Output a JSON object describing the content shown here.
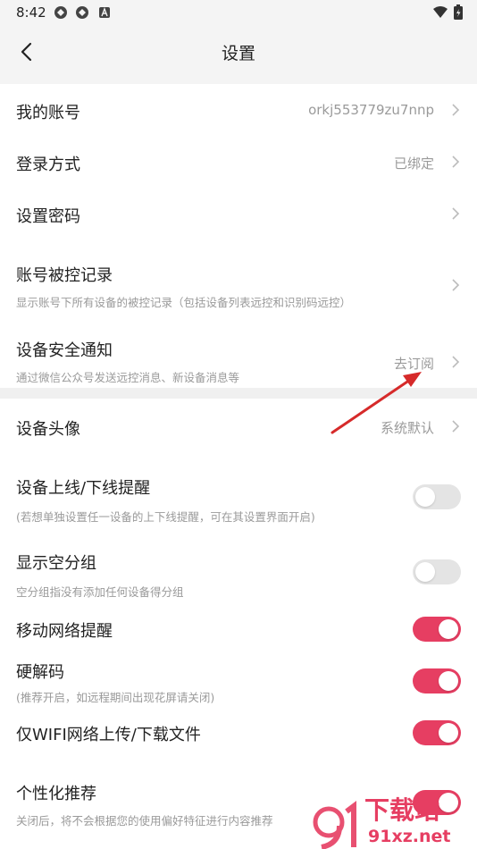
{
  "status_bar": {
    "time": "8:42"
  },
  "header": {
    "title": "设置"
  },
  "rows": [
    {
      "title": "我的账号",
      "value": "orkj553779zu7nnp"
    },
    {
      "title": "登录方式",
      "value": "已绑定"
    },
    {
      "title": "设置密码"
    },
    {
      "title": "账号被控记录",
      "subtitle": "显示账号下所有设备的被控记录（包括设备列表远控和识别码远控）"
    },
    {
      "title": "设备安全通知",
      "subtitle": "通过微信公众号发送远控消息、新设备消息等",
      "value": "去订阅"
    },
    {
      "title": "设备头像",
      "value": "系统默认"
    }
  ],
  "toggles": [
    {
      "title": "设备上线/下线提醒",
      "subtitle": "(若想单独设置任一设备的上下线提醒，可在其设置界面开启)",
      "on": false
    },
    {
      "title": "显示空分组",
      "subtitle": "空分组指没有添加任何设备得分组",
      "on": false
    },
    {
      "title": "移动网络提醒",
      "on": true
    },
    {
      "title": "硬解码",
      "subtitle": "(推荐开启，如远程期间出现花屏请关闭)",
      "on": true
    },
    {
      "title": "仅WIFI网络上传/下载文件",
      "on": true
    },
    {
      "title": "个性化推荐",
      "subtitle": "关闭后，将不会根据您的使用偏好特征进行内容推荐",
      "on": true
    }
  ],
  "watermark": {
    "brand": "下载站",
    "domain": "91xz.net"
  },
  "colors": {
    "accent": "#e63e62",
    "annotation_arrow": "#d62a2a"
  }
}
